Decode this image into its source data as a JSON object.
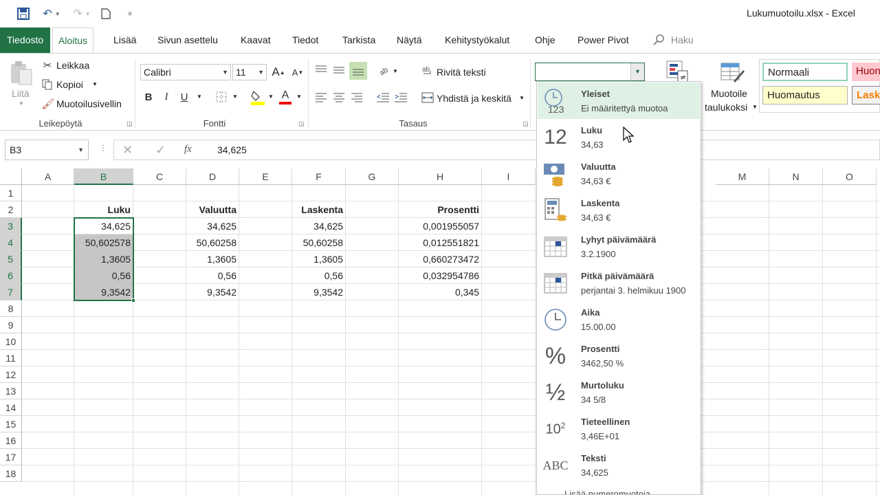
{
  "window": {
    "title": "Lukumuotoilu.xlsx  -  Excel"
  },
  "qat": {
    "save_icon": "save-icon",
    "undo_icon": "undo-icon",
    "redo_icon": "redo-icon",
    "new_icon": "new-document-icon"
  },
  "tabs": [
    "Tiedosto",
    "Aloitus",
    "Lisää",
    "Sivun asettelu",
    "Kaavat",
    "Tiedot",
    "Tarkista",
    "Näytä",
    "Kehitystyökalut",
    "Ohje",
    "Power Pivot",
    "Haku"
  ],
  "ribbon": {
    "clipboard": {
      "paste": "Liitä",
      "cut": "Leikkaa",
      "copy": "Kopioi",
      "format_painter": "Muotoilusivellin",
      "label": "Leikepöytä"
    },
    "font": {
      "name": "Calibri",
      "size": "11",
      "bold": "B",
      "italic": "I",
      "underline": "U",
      "grow": "A",
      "shrink": "A",
      "font_color_letter": "A",
      "label": "Fontti"
    },
    "alignment": {
      "wrap": "Rivitä teksti",
      "merge": "Yhdistä ja keskitä",
      "label": "Tasaus"
    },
    "number_format": {
      "value": ""
    },
    "styles": {
      "format_as_table": "Muotoile",
      "format_as_table2": "taulukoksi",
      "normal": "Normaali",
      "bad": "Huono",
      "note": "Huomautus",
      "calc": "Laskenta"
    }
  },
  "formula_bar": {
    "name_box": "B3",
    "fx": "fx",
    "value": "34,625"
  },
  "grid": {
    "columns": [
      "A",
      "B",
      "C",
      "D",
      "E",
      "F",
      "G",
      "H",
      "I",
      "M",
      "N",
      "O"
    ],
    "rows": [
      "1",
      "2",
      "3",
      "4",
      "5",
      "6",
      "7",
      "8",
      "9",
      "10",
      "11",
      "12",
      "13",
      "14",
      "15",
      "16",
      "17",
      "18"
    ],
    "headers": {
      "B": "Luku",
      "D": "Valuutta",
      "F": "Laskenta",
      "H": "Prosentti"
    },
    "colB": [
      "34,625",
      "50,602578",
      "1,3605",
      "0,56",
      "9,3542"
    ],
    "colD": [
      "34,625",
      "50,60258",
      "1,3605",
      "0,56",
      "9,3542"
    ],
    "colF": [
      "34,625",
      "50,60258",
      "1,3605",
      "0,56",
      "9,3542"
    ],
    "colH": [
      "0,001955057",
      "0,012551821",
      "0,660273472",
      "0,032954786",
      "0,345"
    ]
  },
  "formats": [
    {
      "name": "Yleiset",
      "sample": "Ei määritettyä muotoa",
      "icon": "clock-123-icon"
    },
    {
      "name": "Luku",
      "sample": "34,63",
      "icon": "number-12-icon"
    },
    {
      "name": "Valuutta",
      "sample": "34,63 €",
      "icon": "currency-icon"
    },
    {
      "name": "Laskenta",
      "sample": " 34,63 €",
      "icon": "accounting-icon"
    },
    {
      "name": "Lyhyt päivämäärä",
      "sample": "3.2.1900",
      "icon": "calendar-icon"
    },
    {
      "name": "Pitkä päivämäärä",
      "sample": "perjantai 3. helmikuu 1900",
      "icon": "calendar-icon"
    },
    {
      "name": "Aika",
      "sample": "15.00.00",
      "icon": "clock-icon"
    },
    {
      "name": "Prosentti",
      "sample": "3462,50 %",
      "icon": "percent-icon"
    },
    {
      "name": "Murtoluku",
      "sample": "34 5/8",
      "icon": "fraction-icon"
    },
    {
      "name": "Tieteellinen",
      "sample": "3,46E+01",
      "icon": "scientific-icon"
    },
    {
      "name": "Teksti",
      "sample": "34,625",
      "icon": "text-abc-icon"
    }
  ],
  "icon_text": {
    "n12": "12",
    "pct": "%",
    "half": "½",
    "sci": "10",
    "sci_exp": "2",
    "abc": "ABC",
    "c123": "123"
  },
  "more_formats": "Lisää numeromuotoja...",
  "colors": {
    "accent": "#217346",
    "hover": "#dff0e5",
    "selection": "#c6c6c6"
  }
}
